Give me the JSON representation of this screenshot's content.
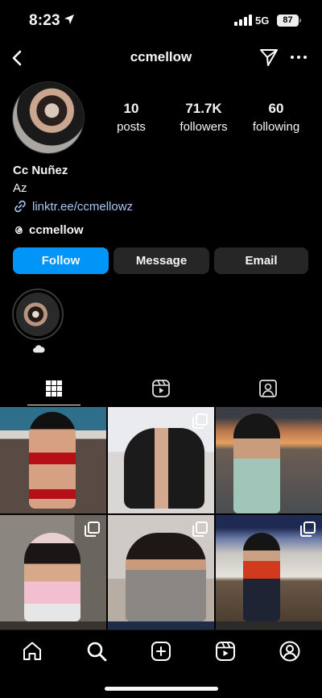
{
  "status_bar": {
    "time": "8:23",
    "network": "5G",
    "battery": "87"
  },
  "header": {
    "username": "ccmellow"
  },
  "stats": [
    {
      "value": "10",
      "label": "posts"
    },
    {
      "value": "71.7K",
      "label": "followers"
    },
    {
      "value": "60",
      "label": "following"
    }
  ],
  "bio": {
    "name": "Cc Nuñez",
    "text": "Az",
    "link": "linktr.ee/ccmellowz",
    "threads_handle": "ccmellow"
  },
  "actions": {
    "follow": "Follow",
    "message": "Message",
    "email": "Email"
  },
  "colors": {
    "accent": "#0095f6",
    "link": "#a7c6f5",
    "button_bg": "#262626",
    "background": "#000000"
  },
  "tabs": [
    {
      "icon": "grid-icon",
      "active": true
    },
    {
      "icon": "reels-icon",
      "active": false
    },
    {
      "icon": "tagged-icon",
      "active": false
    }
  ],
  "bottom_nav": [
    "home-icon",
    "search-icon",
    "create-icon",
    "reels-icon",
    "profile-icon"
  ]
}
